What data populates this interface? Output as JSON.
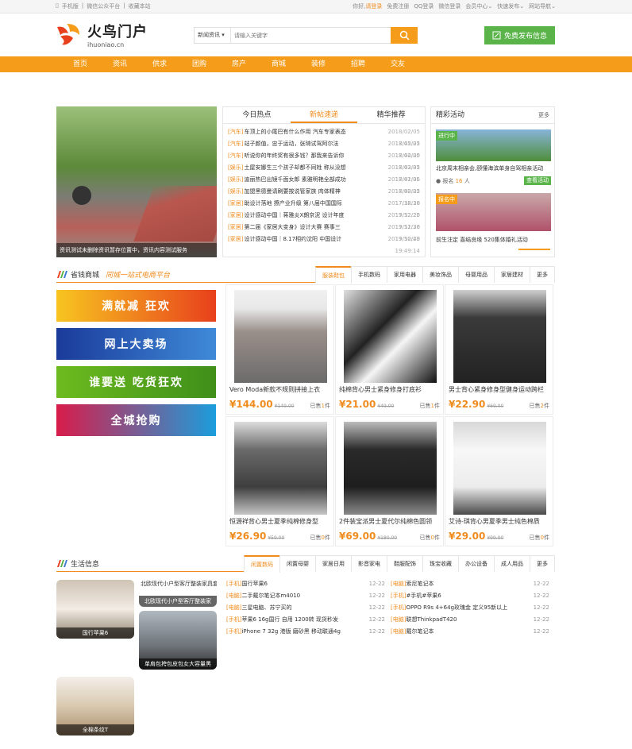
{
  "topbar": {
    "left": [
      "手机版",
      "|",
      "微信公众平台",
      "|",
      "收藏本站"
    ],
    "greeting": "你好,",
    "login": "请登录",
    "right": [
      "免费注册",
      "QQ登录",
      "微信登录",
      "会员中心",
      "快速发布",
      "网站导航"
    ]
  },
  "logo": {
    "main": "火鸟门户",
    "sub": "ihuoniao.cn"
  },
  "search": {
    "category": "新闻资讯",
    "placeholder": "请输入关键字"
  },
  "publish_label": "免费发布信息",
  "nav": [
    "首页",
    "资讯",
    "供求",
    "团购",
    "房产",
    "商城",
    "装修",
    "招聘",
    "交友"
  ],
  "headline": {
    "caption": "资讯测试未删除资讯暂存位置中，资讯内容测试服务"
  },
  "news": {
    "tabs": [
      "今日热点",
      "新帖速递",
      "精华推荐"
    ],
    "active_tab": 1,
    "items": [
      {
        "tag": "[汽车]",
        "title": "车顶上的小尾巴有什么作用 汽车专家表态",
        "date": "2018/02/05 17:45:22"
      },
      {
        "tag": "[汽车]",
        "title": "站子颜值，忠于运动，张琦试驾阿尔法",
        "date": "2018/02/05 17:44:20"
      },
      {
        "tag": "[汽车]",
        "title": "听说你的年终奖有很多钱？那我来告诉你",
        "date": "2018/02/05 17:43:32"
      },
      {
        "tag": "[娱乐]",
        "title": "土屋安娜生三个孩子却都不同姓 称从没想",
        "date": "2018/02/05 17:41:36"
      },
      {
        "tag": "[娱乐]",
        "title": "迪丽热巴出镜千面女郎 素雅明艳全部成功",
        "date": "2018/02/05 17:40:22"
      },
      {
        "tag": "[娱乐]",
        "title": "加盟黑德曼请刷要按说管家族 肉体精神",
        "date": "2018/02/05 17:38:38"
      },
      {
        "tag": "[家居]",
        "title": "助设计落地 撩产业升级 第八届中国国际",
        "date": "2017/12/20 19:52:25"
      },
      {
        "tag": "[家居]",
        "title": "设计感动中国｜蒋雅炎X朗京泥 设计年度",
        "date": "2017/12/20 19:51:36"
      },
      {
        "tag": "[家居]",
        "title": "第二届《家居大变身》设计大赛 赛事三",
        "date": "2017/12/20 19:50:43"
      },
      {
        "tag": "[家居]",
        "title": "设计感动中国｜8.17相约沈阳 中国设计",
        "date": "2017/12/20 19:49:14"
      }
    ]
  },
  "activity": {
    "title": "精彩活动",
    "more": "更多",
    "items": [
      {
        "badge": "进行中",
        "title": "北京周末相亲会,颐懂海滨单身自驾相亲活动",
        "meta_label": "报名",
        "count": "16",
        "count_unit": "人",
        "button": "查看活动"
      },
      {
        "badge": "报名中",
        "title": "前生注定 喜结良缘 520集体婚礼活动"
      }
    ]
  },
  "mall": {
    "title": "省钱商城",
    "slogan": "同城一站式电商平台",
    "tabs": [
      "服装鞋包",
      "手机数码",
      "家用电器",
      "美妆饰品",
      "母婴用品",
      "家居建材",
      "更多"
    ],
    "banners": [
      "满就减 狂欢",
      "网上大卖场",
      "谁要送 吃货狂欢",
      "全城抢购"
    ],
    "products": [
      {
        "title": "Vero Moda新款不规则拼接上衣",
        "price": "¥144.00",
        "old": "¥149.00",
        "sold_pre": "已售",
        "sold": "1",
        "sold_post": "件"
      },
      {
        "title": "纯棉背心男士紧身修身打底衫",
        "price": "¥21.00",
        "old": "¥49.00",
        "sold_pre": "已售",
        "sold": "1",
        "sold_post": "件"
      },
      {
        "title": "男士背心紧身修身型健身运动跨栏",
        "price": "¥22.90",
        "old": "¥69.00",
        "sold_pre": "已售",
        "sold": "2",
        "sold_post": "件"
      },
      {
        "title": "恒源祥背心男士夏季纯棉修身型",
        "price": "¥26.90",
        "old": "¥59.00",
        "sold_pre": "已售",
        "sold": "0",
        "sold_post": "件"
      },
      {
        "title": "2件装宝派男士夏代尔纯棉色圆领",
        "price": "¥69.00",
        "old": "¥180.00",
        "sold_pre": "已售",
        "sold": "0",
        "sold_post": "件"
      },
      {
        "title": "艾诗-琪背心男夏季男士纯色棉质",
        "price": "¥29.00",
        "old": "¥99.00",
        "sold_pre": "已售",
        "sold": "0",
        "sold_post": "件"
      }
    ]
  },
  "life": {
    "title": "生活信息",
    "tabs": [
      "闲置数码",
      "闲置母婴",
      "家居日用",
      "影音家电",
      "鞋服配饰",
      "珠宝收藏",
      "办公设备",
      "成人用品",
      "更多"
    ],
    "pics": [
      {
        "caption": "国行苹果6",
        "alt": ""
      },
      {
        "caption": "北欧现代小户型客厅整装家",
        "alt": "北欧现代小户型客厅整装家具套装沙发单人双人三人"
      },
      {
        "caption": "单肩包挎包皮包女大容量黑",
        "alt": ""
      },
      {
        "caption": "全棉条纹T",
        "alt": ""
      }
    ],
    "list_left": [
      {
        "tag": "[手机]",
        "title": "国行苹果6",
        "date": "12-22"
      },
      {
        "tag": "[电脑]",
        "title": "二手戴尔笔记本m4010",
        "date": "12-22"
      },
      {
        "tag": "[电脑]",
        "title": "三星电脑、苏宁买的",
        "date": "12-22"
      },
      {
        "tag": "[手机]",
        "title": "苹果6 16g国行 自用 1200转 现货秒发",
        "date": "12-22"
      },
      {
        "tag": "[手机]",
        "title": "iPhone 7 32g 港版 磨砂黑 移动联通4g",
        "date": "12-22"
      }
    ],
    "list_right": [
      {
        "tag": "[电脑]",
        "title": "索尼笔记本",
        "date": "12-22"
      },
      {
        "tag": "[手机]",
        "title": "#手机#苹果6",
        "date": "12-22"
      },
      {
        "tag": "[手机]",
        "title": "OPPO R9s 4+64g玫瑰金 定义95新以上",
        "date": "12-22"
      },
      {
        "tag": "[电脑]",
        "title": "联想ThinkpadT420",
        "date": "12-22"
      },
      {
        "tag": "[电脑]",
        "title": "戴尔笔记本",
        "date": "12-22"
      }
    ]
  },
  "colors": {
    "accent": "#f59d1a",
    "green": "#5ab44a",
    "text": "#333333"
  }
}
